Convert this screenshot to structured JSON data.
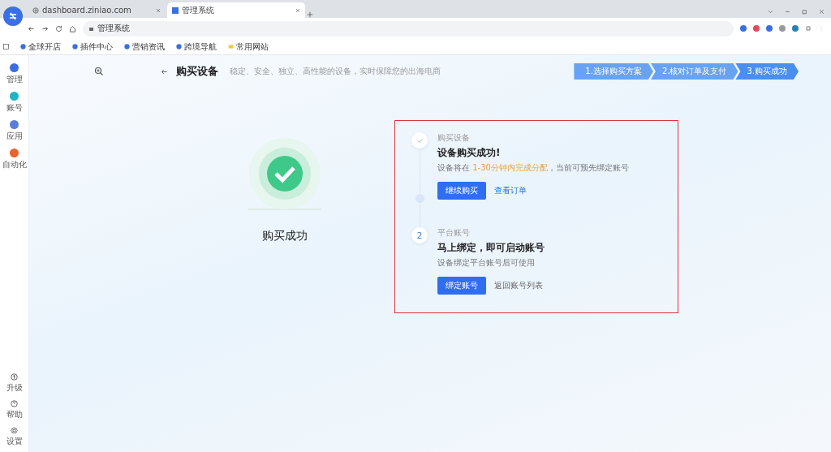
{
  "browser": {
    "tabs": [
      {
        "title": "dashboard.ziniao.com",
        "selected": false
      },
      {
        "title": "管理系统",
        "selected": true
      }
    ],
    "address": "管理系统",
    "bookmarks": [
      "全球开店",
      "插件中心",
      "营销资讯",
      "跨境导航",
      "常用网站"
    ]
  },
  "sidebar": {
    "top": [
      {
        "label": "管理",
        "color": "#3b6fe0"
      },
      {
        "label": "账号",
        "color": "#21b4c4"
      },
      {
        "label": "应用",
        "color": "#5a7fd8"
      },
      {
        "label": "自动化",
        "color": "#e8642c"
      }
    ],
    "bottom": [
      {
        "label": "升级",
        "kind": "upgrade"
      },
      {
        "label": "帮助",
        "kind": "help"
      },
      {
        "label": "设置",
        "kind": "settings"
      }
    ]
  },
  "header": {
    "title": "购买设备",
    "subtitle": "稳定、安全、独立、高性能的设备，实时保障您的出海电商"
  },
  "steps": [
    {
      "label": "1.选择购买方案",
      "selected": false
    },
    {
      "label": "2.核对订单及支付",
      "selected": false
    },
    {
      "label": "3.购买成功",
      "selected": true
    }
  ],
  "result": {
    "caption": "购买成功"
  },
  "timeline": [
    {
      "kind": "done",
      "tag": "购买设备",
      "title": "设备购买成功!",
      "desc_before": "设备将在 ",
      "desc_highlight": "1-30分钟内完成分配",
      "desc_after": "，当前可预先绑定账号",
      "primary": "继续购买",
      "link": "查看订单"
    },
    {
      "kind": "number",
      "marker": "2",
      "tag": "平台账号",
      "title": "马上绑定，即可启动账号",
      "desc_before": "设备绑定平台账号后可使用",
      "primary": "绑定账号",
      "link": "返回账号列表"
    }
  ]
}
